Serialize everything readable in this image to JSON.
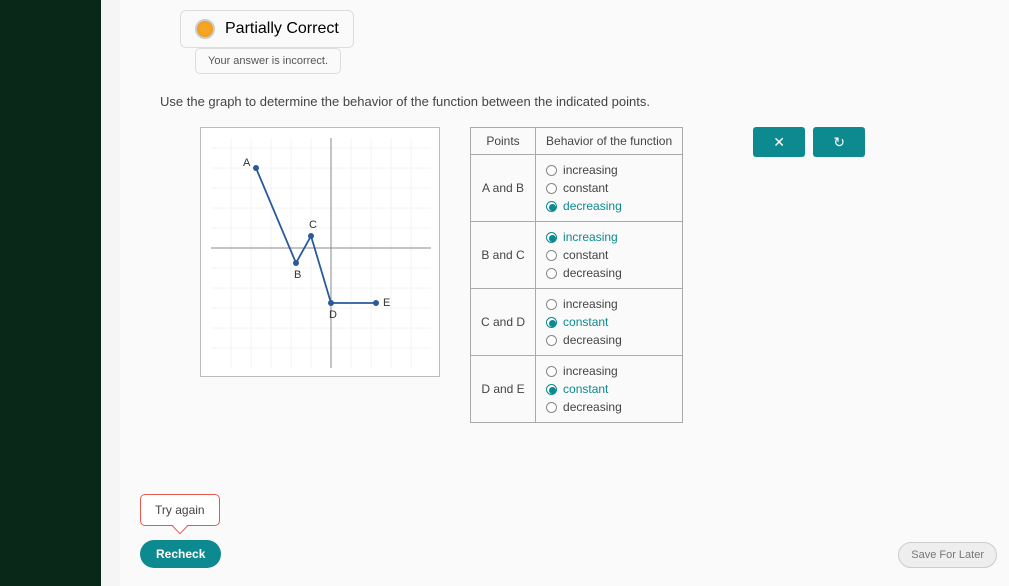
{
  "status": {
    "title": "Partially Correct",
    "subtitle": "Your answer is incorrect."
  },
  "question": "Use the graph to determine the behavior of the function between the indicated points.",
  "graph": {
    "points": [
      {
        "label": "A",
        "x": -7,
        "y": 6
      },
      {
        "label": "B",
        "x": -3,
        "y": -1
      },
      {
        "label": "C",
        "x": -2,
        "y": 1
      },
      {
        "label": "D",
        "x": 0,
        "y": -4
      },
      {
        "label": "E",
        "x": 3,
        "y": -4
      }
    ],
    "x_range": [
      -9,
      9
    ],
    "y_range": [
      -9,
      9
    ]
  },
  "table": {
    "header_points": "Points",
    "header_behavior": "Behavior of the function",
    "options": [
      "increasing",
      "constant",
      "decreasing"
    ],
    "rows": [
      {
        "label": "A and B",
        "selected": "decreasing"
      },
      {
        "label": "B and C",
        "selected": "increasing"
      },
      {
        "label": "C and D",
        "selected": "constant"
      },
      {
        "label": "D and E",
        "selected": "constant"
      }
    ]
  },
  "buttons": {
    "try_again": "Try again",
    "recheck": "Recheck",
    "save_later": "Save For Later"
  },
  "action_icons": {
    "clear": "✕",
    "reset": "↻"
  }
}
